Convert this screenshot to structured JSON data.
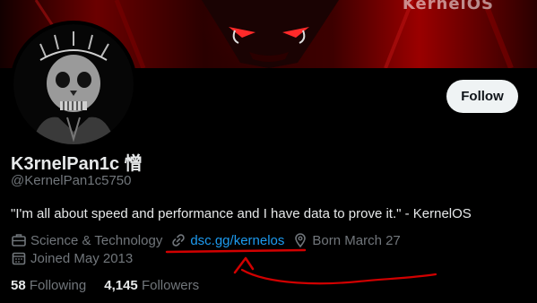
{
  "banner": {
    "watermark": "KernelOS"
  },
  "profile": {
    "display_name": "K3rnelPan1c 憎",
    "handle": "@KernelPan1c5750",
    "bio": "\"I'm all about speed and performance and I have data to prove it.\" - KernelOS",
    "follow_label": "Follow"
  },
  "meta": {
    "category": "Science & Technology",
    "link": "dsc.gg/kernelos",
    "born": "Born March 27",
    "joined": "Joined May 2013"
  },
  "stats": {
    "following_count": "58",
    "following_label": "Following",
    "followers_count": "4,145",
    "followers_label": "Followers"
  },
  "colors": {
    "background": "#000000",
    "link": "#1d9bf0",
    "muted": "#71767b",
    "annotation": "#d10000"
  },
  "icons": {
    "category": "briefcase-icon",
    "link": "link-icon",
    "born": "location-pin-icon",
    "joined": "calendar-icon"
  }
}
